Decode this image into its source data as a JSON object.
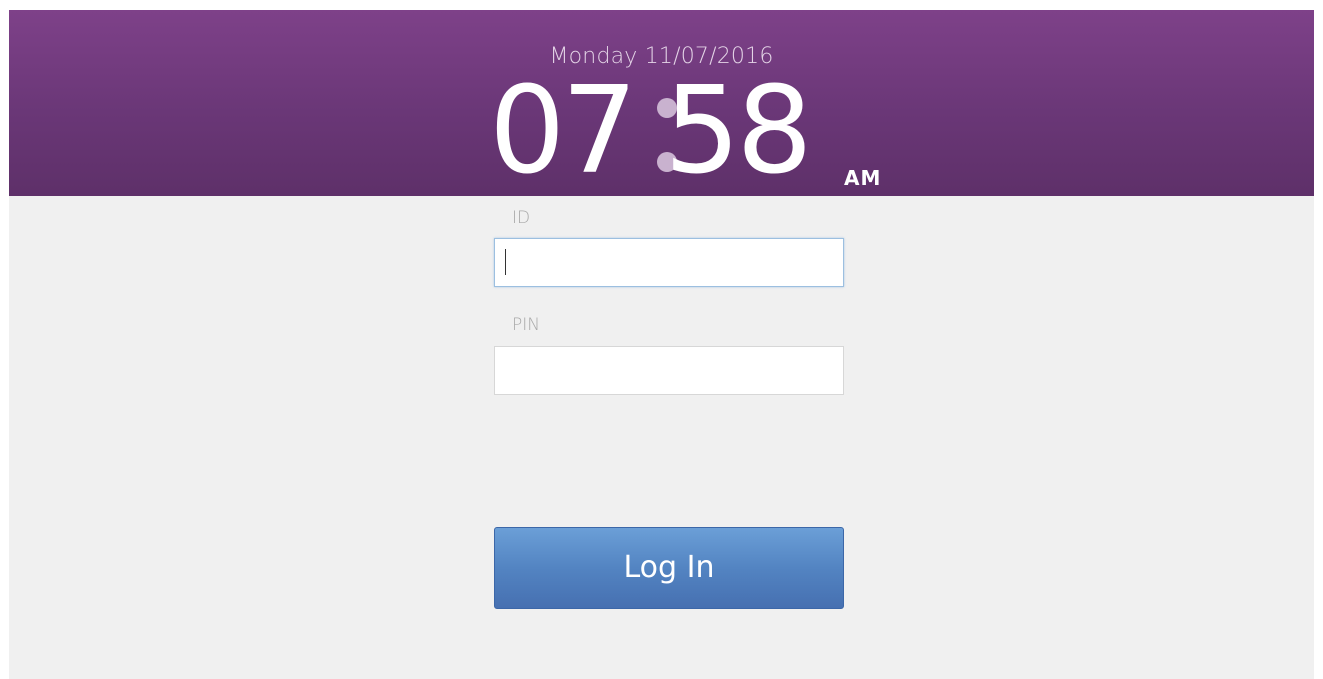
{
  "header": {
    "date": "Monday 11/07/2016",
    "time_hours": "07",
    "time_minutes": "58",
    "ampm": "AM"
  },
  "form": {
    "id_label": "ID",
    "id_value": "",
    "pin_label": "PIN",
    "pin_value": ""
  },
  "login_button": {
    "label": "Log In"
  },
  "colors": {
    "header_purple": "#6a3777",
    "background": "#f0f0f0",
    "button_blue": "#5384c2"
  }
}
